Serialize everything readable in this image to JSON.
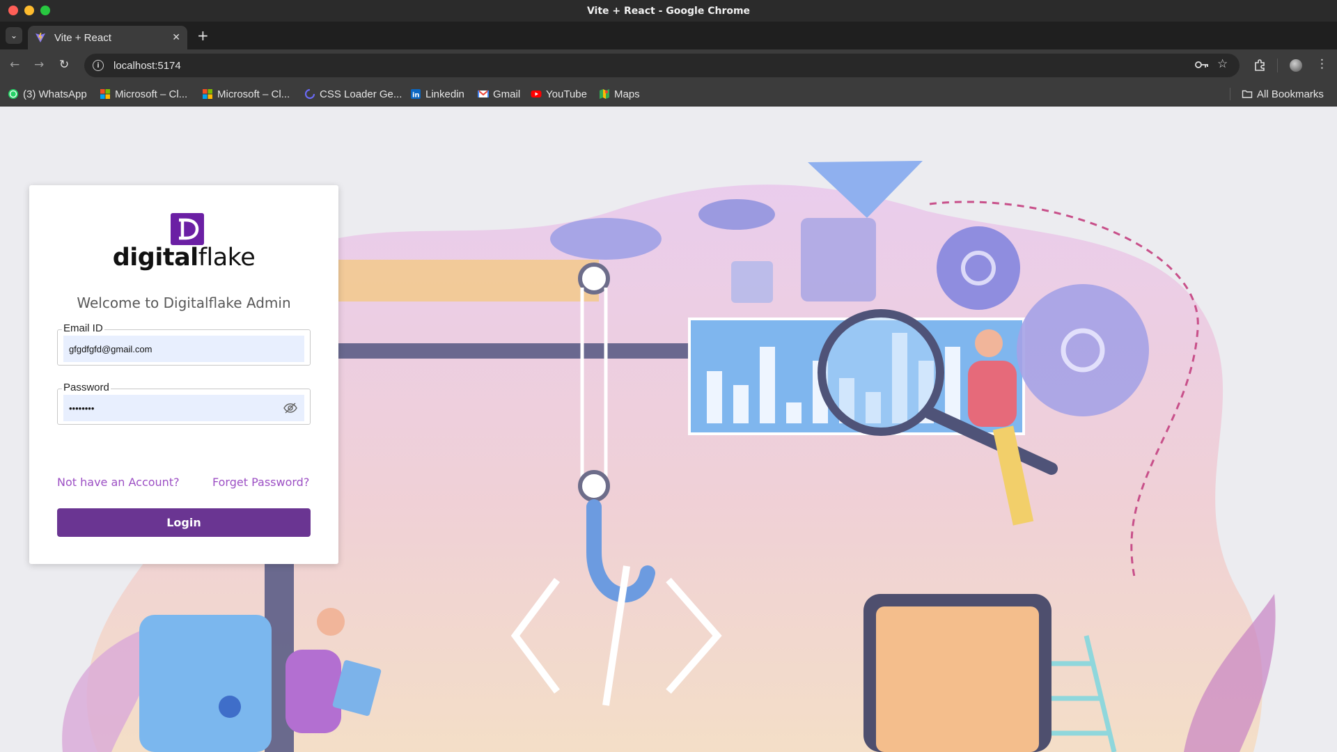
{
  "window": {
    "title": "Vite + React - Google Chrome"
  },
  "tabs": [
    {
      "title": "Vite + React",
      "active": true
    }
  ],
  "toolbar": {
    "url": "localhost:5174"
  },
  "bookmarks": {
    "items": [
      {
        "label": "(3) WhatsApp",
        "icon": "whatsapp-icon",
        "color": "#25d366"
      },
      {
        "label": "Microsoft – Cl...",
        "icon": "microsoft-icon",
        "color": "#f25022"
      },
      {
        "label": "Microsoft – Cl...",
        "icon": "microsoft-icon",
        "color": "#f25022"
      },
      {
        "label": "CSS Loader Ge...",
        "icon": "css-loader-icon",
        "color": "#5b5bf0"
      },
      {
        "label": "Linkedin",
        "icon": "linkedin-icon",
        "color": "#0a66c2"
      },
      {
        "label": "Gmail",
        "icon": "gmail-icon",
        "color": "#ea4335"
      },
      {
        "label": "YouTube",
        "icon": "youtube-icon",
        "color": "#ff0000"
      },
      {
        "label": "Maps",
        "icon": "maps-icon",
        "color": "#34a853"
      }
    ],
    "all_bookmarks_label": "All Bookmarks"
  },
  "login": {
    "brand_bold": "digital",
    "brand_light": "flake",
    "welcome": "Welcome to Digitalflake Admin",
    "email_label": "Email ID",
    "email_value": "gfgdfgfd@gmail.com",
    "password_label": "Password",
    "password_value": "••••••••",
    "signup_link": "Not have an Account?",
    "forgot_link": "Forget Password?",
    "login_button": "Login",
    "brand_color": "#6b1fa4",
    "button_color": "#6a3592"
  }
}
